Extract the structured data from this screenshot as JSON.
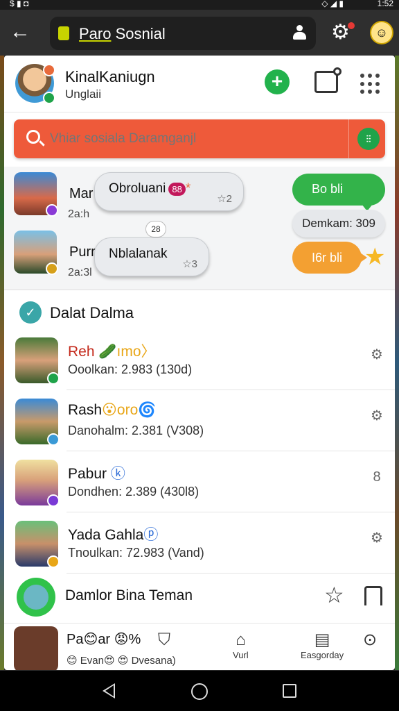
{
  "status_bar": {
    "left": "$ ▮ ◘",
    "signal": "◇ ◢ ▮",
    "time": "1:52"
  },
  "header": {
    "title_prefix": "Paro",
    "title_rest": " Sosnial",
    "back_icon": "arrow-left-icon",
    "actions": [
      "person-icon",
      "gear-icon",
      "avatar"
    ]
  },
  "profile": {
    "name": "KinalKaniugn",
    "subtitle": "Unglaii"
  },
  "search": {
    "placeholder": "Vhiar sosiala Daramganjl",
    "filter_label": "filter"
  },
  "conversations": [
    {
      "name": "Mar",
      "time": "2a:h",
      "bubble": "Obroluani",
      "bubble_count": "88",
      "bubble_extra": "☆2",
      "bubble_star": "*"
    },
    {
      "name": "Purr",
      "time": "2a:3l",
      "bubble": "Nblalanak",
      "bubble_extra": "☆3"
    }
  ],
  "small_pill": "28",
  "quick_actions": {
    "green": "Bo bli",
    "grey": "Demkam: 309",
    "orange": "I6r bli"
  },
  "section": {
    "title": "Dalat Dalma"
  },
  "contacts": [
    {
      "name": "Reh",
      "emoji": "🥒ımo〉",
      "sub": "Ooolkan: 2.983 (130d)",
      "color": "#c42a1c"
    },
    {
      "name": "Rash",
      "emoji": "😮oro🌀",
      "sub": "Danohalm: 2.381 (V308)"
    },
    {
      "name": "Pabur",
      "emoji": " ⓚ",
      "sub": "Dondhen: 2.389 (430l8)"
    },
    {
      "name": "Yada Gahla",
      "emoji": "ⓟ",
      "sub": "Tnoulkan: 72.983 (Vand)"
    }
  ],
  "friends": {
    "label": "Damlor Bina Teman"
  },
  "bottom_row": {
    "name": "Pa😊ar 😡%",
    "sub": "😊 Evan😍 😍 Dvesana)",
    "nav": [
      {
        "label": "",
        "icon": "bag-icon"
      },
      {
        "label": "Vurl",
        "icon": "home-icon"
      },
      {
        "label": "Easgorday",
        "icon": "list-icon"
      },
      {
        "label": "",
        "icon": "location-icon"
      }
    ]
  },
  "colors": {
    "accent_orange": "#ee5a3a",
    "accent_green": "#33b34a",
    "accent_yellow": "#c8d400"
  }
}
